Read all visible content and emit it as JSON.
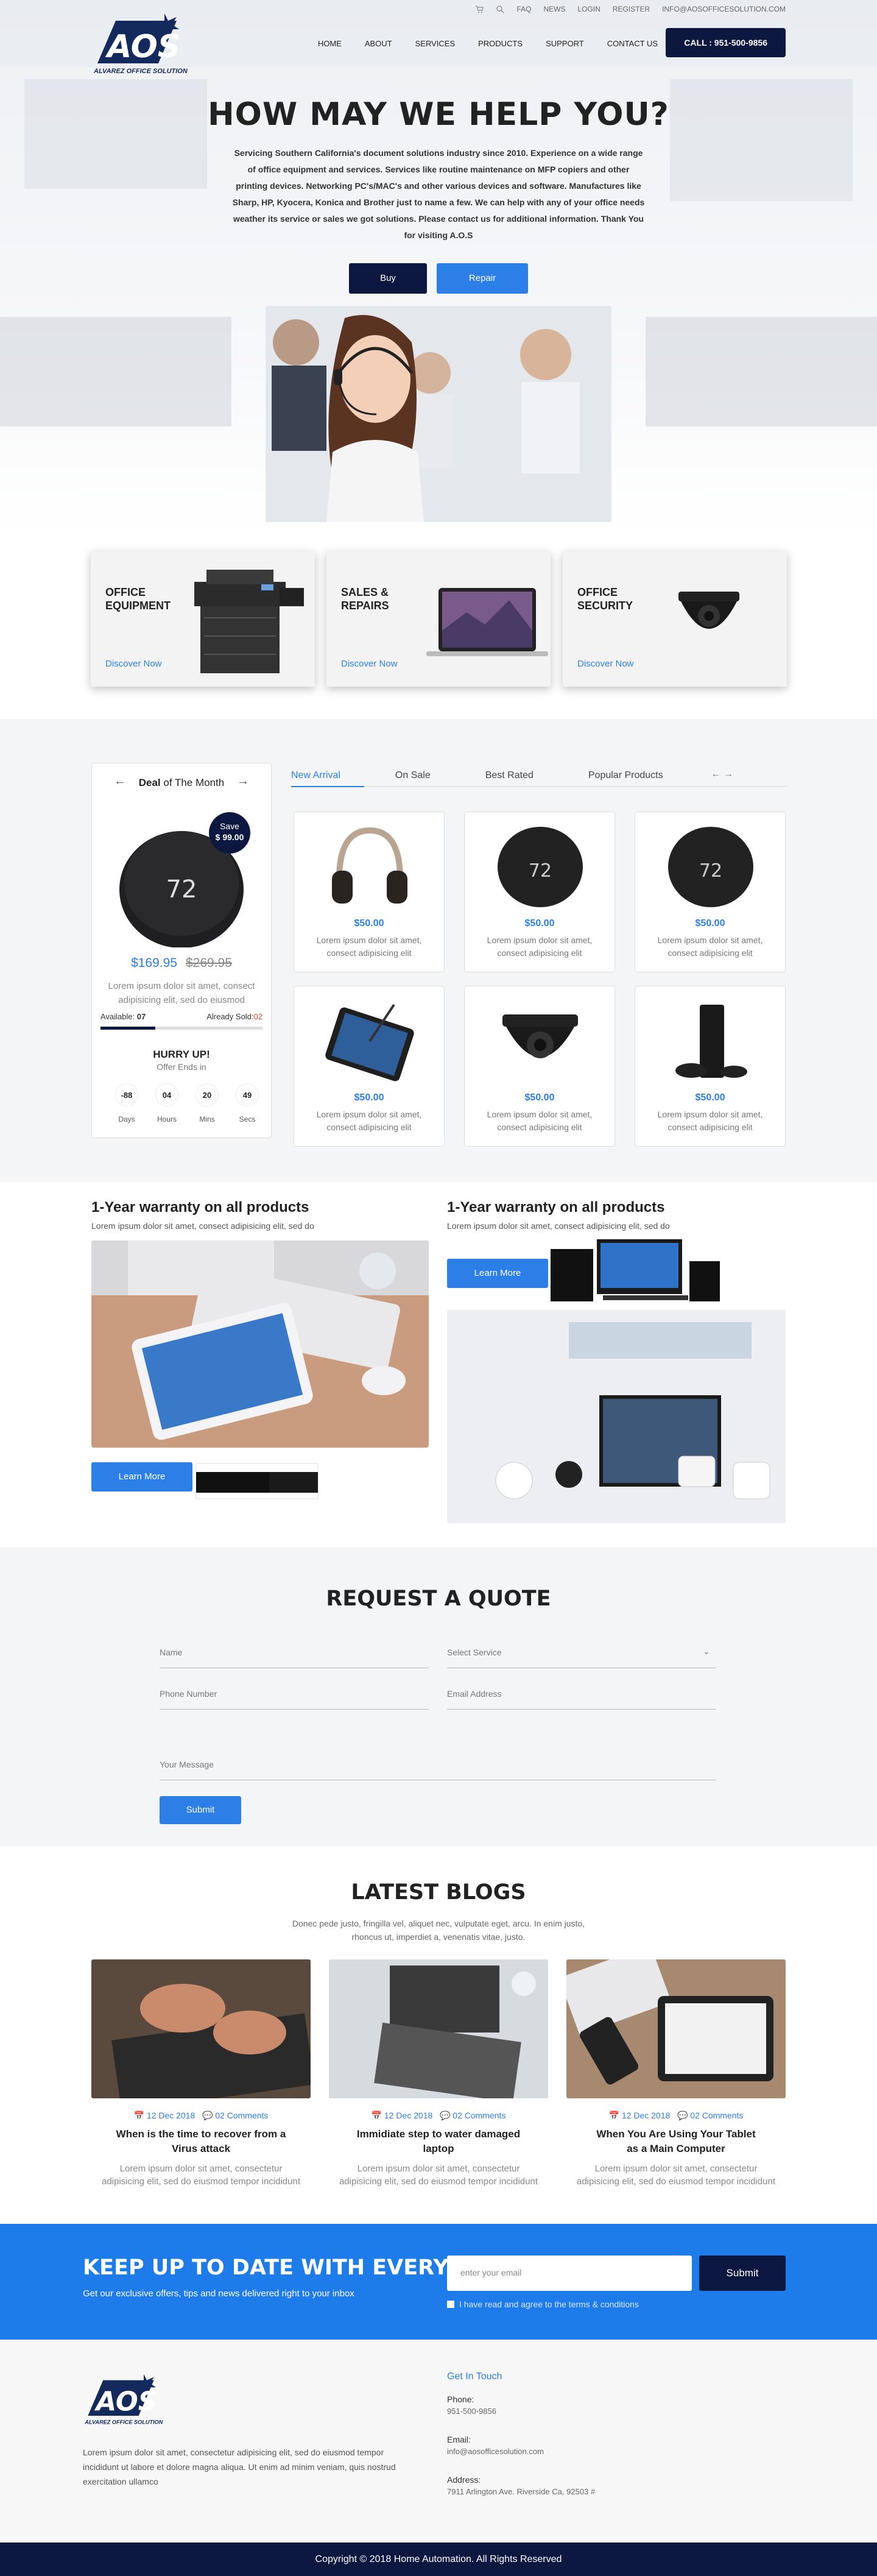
{
  "topbar": {
    "links": [
      "FAQ",
      "NEWS",
      "LOGIN",
      "REGISTER",
      "INFO@AOSOFFICESOLUTION.COM"
    ]
  },
  "nav": {
    "logo_text": "AOS",
    "logo_caption": "ALVAREZ OFFICE SOLUTION",
    "links": [
      "HOME",
      "ABOUT",
      "SERVICES",
      "PRODUCTS",
      "SUPPORT",
      "CONTACT US"
    ],
    "call": "CALL : 951-500-9856"
  },
  "hero": {
    "title": "HOW MAY WE HELP YOU?",
    "intro": "Servicing Southern California's document solutions industry since 2010. Experience on a wide range of office equipment and services. Services like routine maintenance on MFP copiers and other printing devices. Networking PC's/MAC's and other various devices and software. Manufactures like Sharp, HP, Kyocera, Konica and Brother just to name a few. We can help with any of your office needs weather its service or sales we got solutions. Please contact us for additional information. Thank You for visiting A.O.S",
    "buy": "Buy",
    "repair": "Repair"
  },
  "categories": [
    {
      "title": "OFFICE EQUIPMENT",
      "link": "Discover Now"
    },
    {
      "title": "SALES & REPAIRS",
      "link": "Discover Now"
    },
    {
      "title": "OFFICE SECURITY",
      "link": "Discover Now"
    }
  ],
  "deal": {
    "label_bold": "Deal",
    "label_rest": " of The Month",
    "save_label": "Save",
    "save_amount": "$ 99.00",
    "price": "$169.95",
    "old_price": "$269.95",
    "desc": "Lorem ipsum dolor sit amet, consect adipisicing elit, sed do eiusmod",
    "available_label": "Available:",
    "available": "07",
    "sold_label": "Already Sold:",
    "sold": "02",
    "sold_fraction": 0.34,
    "hurry": "HURRY UP!",
    "offer": "Offer Ends in",
    "countdown": [
      {
        "n": "-88",
        "l": "Days"
      },
      {
        "n": "04",
        "l": "Hours"
      },
      {
        "n": "20",
        "l": "Mins"
      },
      {
        "n": "49",
        "l": "Secs"
      }
    ]
  },
  "tabs": [
    "New Arrival",
    "On Sale",
    "Best Rated",
    "Popular Products"
  ],
  "products": [
    {
      "price": "$50.00",
      "desc": "Lorem ipsum dolor sit amet, consect adipisicing elit",
      "icon": "headphones-icon"
    },
    {
      "price": "$50.00",
      "desc": "Lorem ipsum dolor sit amet, consect adipisicing elit",
      "icon": "thermostat-icon"
    },
    {
      "price": "$50.00",
      "desc": "Lorem ipsum dolor sit amet, consect adipisicing elit",
      "icon": "thermostat-icon"
    },
    {
      "price": "$50.00",
      "desc": "Lorem ipsum dolor sit amet, consect adipisicing elit",
      "icon": "tablet-icon"
    },
    {
      "price": "$50.00",
      "desc": "Lorem ipsum dolor sit amet, consect adipisicing elit",
      "icon": "camera-icon"
    },
    {
      "price": "$50.00",
      "desc": "Lorem ipsum dolor sit amet, consect adipisicing elit",
      "icon": "console-icon"
    }
  ],
  "warranty": [
    {
      "title": "1-Year warranty on all products",
      "sub": "Lorem ipsum dolor sit amet, consect adipisicing elit, sed do",
      "button": "Learn More"
    },
    {
      "title": "1-Year warranty on all products",
      "sub": "Lorem ipsum dolor sit amet, consect adipisicing elit, sed do",
      "button": "Learn More"
    }
  ],
  "quote": {
    "title": "REQUEST A QUOTE",
    "name": "Name",
    "service": "Select Service",
    "phone": "Phone Number",
    "email": "Email Address",
    "message": "Your Message",
    "submit": "Submit"
  },
  "blogs": {
    "title": "LATEST BLOGS",
    "sub": "Donec pede justo, fringilla vel, aliquet nec, vulputate eget, arcu. In enim justo, rhoncus ut, imperdiet a, venenatis vitae, justo.",
    "items": [
      {
        "date": "12 Dec 2018",
        "comments": "02 Comments",
        "title": "When is the time to recover from a Virus attack",
        "desc": "Lorem ipsum dolor sit amet, consectetur adipisicing elit, sed do eiusmod tempor incididunt"
      },
      {
        "date": "12 Dec 2018",
        "comments": "02 Comments",
        "title": "Immidiate step to water damaged laptop",
        "desc": "Lorem ipsum dolor sit amet, consectetur adipisicing elit, sed do eiusmod tempor incididunt"
      },
      {
        "date": "12 Dec 2018",
        "comments": "02 Comments",
        "title": "When You Are Using Your Tablet as a Main Computer",
        "desc": "Lorem ipsum dolor sit amet, consectetur adipisicing elit, sed do eiusmod tempor incididunt"
      }
    ]
  },
  "newsletter": {
    "title": "KEEP UP TO DATE WITH EVERYTHING",
    "sub": "Get our exclusive offers, tips and news delivered right to your inbox",
    "placeholder": "enter your email",
    "submit": "Submit",
    "agree": "I have read and agree to the terms & conditions"
  },
  "footer": {
    "desc": "Lorem ipsum dolor sit amet, consectetur adipisicing elit, sed do eiusmod tempor incididunt ut labore et dolore magna aliqua. Ut enim ad minim veniam, quis nostrud exercitation ullamco",
    "get_in_touch": "Get In Touch",
    "phone_label": "Phone:",
    "phone": "951-500-9856",
    "email_label": "Email:",
    "email": "info@aosofficesolution.com",
    "address_label": "Address:",
    "address": "7911 Arlington Ave. Riverside Ca, 92503 #",
    "copyright": "Copyright © 2018 Home Automation. All Rights Reserved"
  },
  "colors": {
    "navy": "#0c1840",
    "blue": "#2b7fe6",
    "newsletter": "#1d7bea"
  }
}
